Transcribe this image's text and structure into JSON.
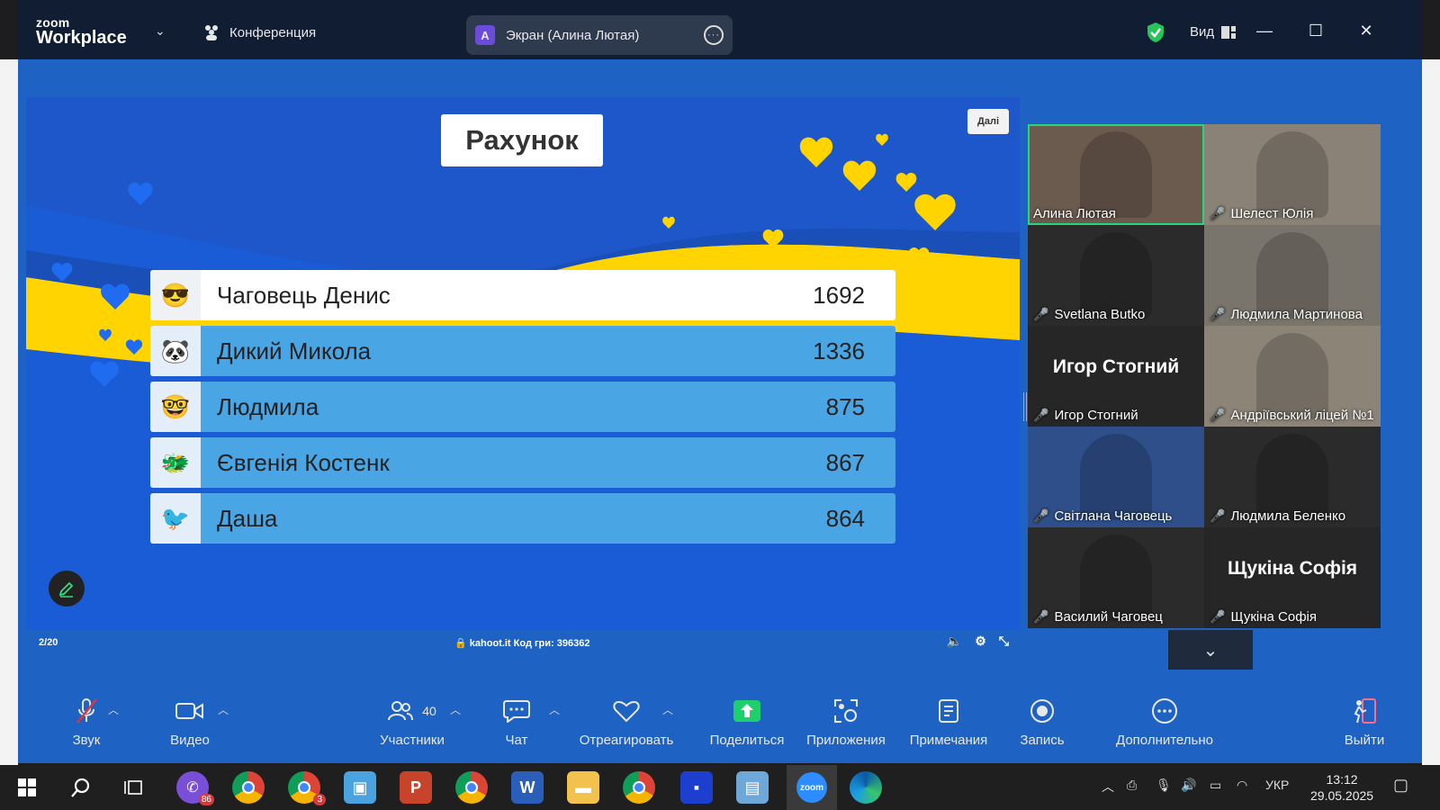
{
  "titlebar": {
    "logo_top": "zoom",
    "logo_bottom": "Workplace",
    "meeting_label": "Конференция",
    "share_avatar": "A",
    "share_label": "Экран (Алина Лютая)",
    "view_label": "Вид"
  },
  "slide": {
    "title": "Рахунок",
    "next_label": "Далі",
    "page": "2/20",
    "game_code": "kahoot.it  Код гри: 396362",
    "leaderboard": [
      {
        "name": "Чаговець Денис",
        "score": "1692",
        "avatar_icon": "sunglasses-avatar-icon"
      },
      {
        "name": "Дикий Микола",
        "score": "1336",
        "avatar_icon": "panda-avatar-icon"
      },
      {
        "name": "Людмила",
        "score": "875",
        "avatar_icon": "glasses-avatar-icon"
      },
      {
        "name": "Євгенія Костенк",
        "score": "867",
        "avatar_icon": "monster-avatar-icon"
      },
      {
        "name": "Даша",
        "score": "864",
        "avatar_icon": "party-bird-avatar-icon"
      }
    ]
  },
  "gallery": {
    "tiles": [
      {
        "name": "Алина Лютая",
        "muted": false,
        "active": true,
        "show_big_name": false
      },
      {
        "name": "Шелест Юлія",
        "muted": true,
        "active": false,
        "show_big_name": false
      },
      {
        "name": "Svetlana Butko",
        "muted": true,
        "active": false,
        "show_big_name": false
      },
      {
        "name": "Людмила Мартинова",
        "muted": true,
        "active": false,
        "show_big_name": false
      },
      {
        "name": "Игор Стогний",
        "muted": true,
        "active": false,
        "show_big_name": true
      },
      {
        "name": "Андріївський ліцей №1",
        "muted": true,
        "active": false,
        "show_big_name": false
      },
      {
        "name": "Світлана Чаговець",
        "muted": true,
        "active": false,
        "show_big_name": false
      },
      {
        "name": "Людмила Беленко",
        "muted": true,
        "active": false,
        "show_big_name": false
      },
      {
        "name": "Василий Чаговец",
        "muted": true,
        "active": false,
        "show_big_name": false
      },
      {
        "name": "Щукіна Софія",
        "muted": true,
        "active": false,
        "show_big_name": true
      }
    ]
  },
  "toolbar": {
    "audio": "Звук",
    "video": "Видео",
    "participants": "Участники",
    "participants_count": "40",
    "chat": "Чат",
    "react": "Отреагировать",
    "share": "Поделиться",
    "apps": "Приложения",
    "notes": "Примечания",
    "record": "Запись",
    "more": "Дополнительно",
    "leave": "Выйти"
  },
  "taskbar": {
    "viber_badge": "86",
    "chrome_badge": "3",
    "lang": "УКР",
    "time": "13:12",
    "date": "29.05.2025"
  },
  "colors": {
    "zoom_blue": "#1e63c4",
    "title_dark": "#101d33",
    "kahoot_row": "#4aa5e4",
    "active_speaker": "#27d57b",
    "muted_red": "#e0353a",
    "heart_yellow": "#ffd400"
  }
}
